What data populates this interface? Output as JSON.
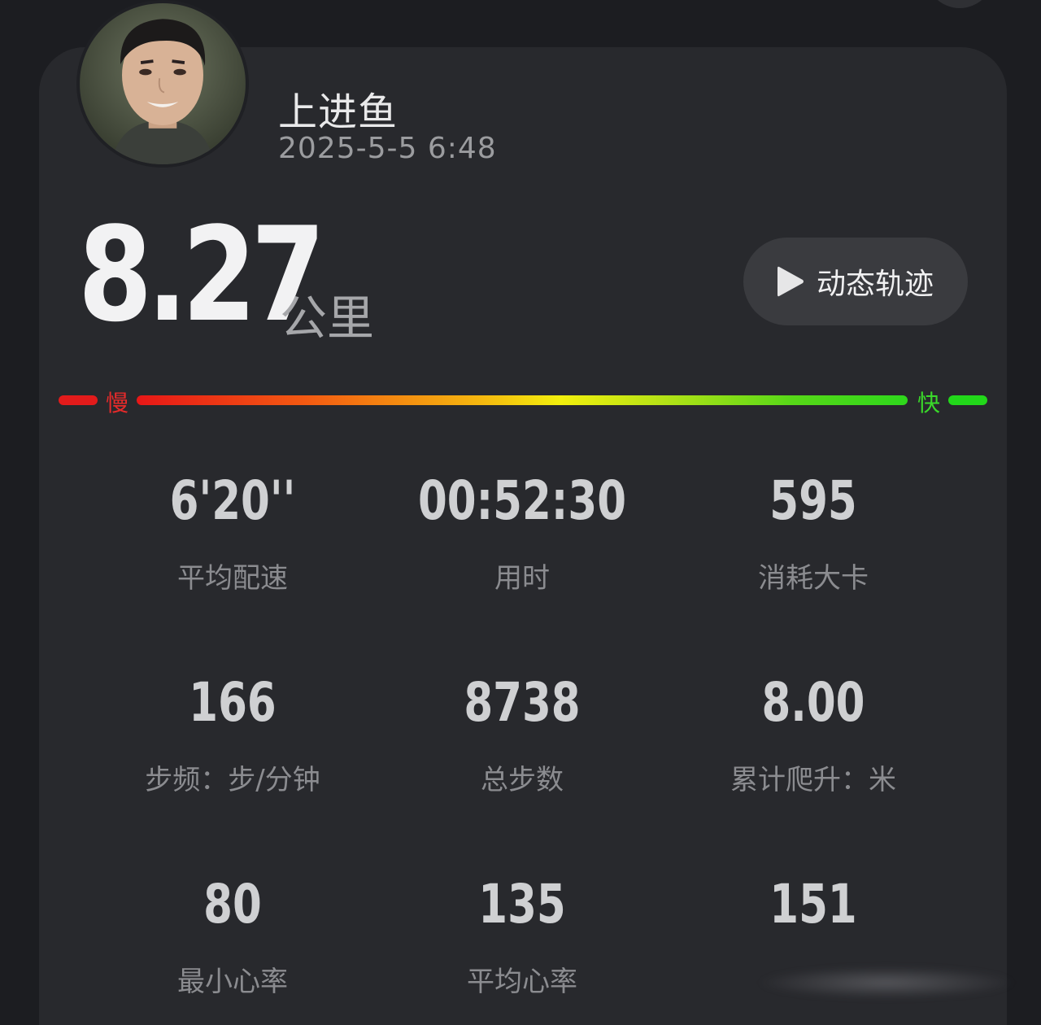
{
  "profile": {
    "name": "上进鱼",
    "timestamp": "2025-5-5 6:48"
  },
  "distance": {
    "value": "8.27",
    "unit": "公里"
  },
  "track_button": {
    "label": "动态轨迹",
    "icon": "play-icon"
  },
  "speed_legend": {
    "slow_label": "慢",
    "fast_label": "快",
    "slow_color": "#e71717",
    "fast_color": "#2ed81c"
  },
  "stats": [
    {
      "value": "6'20''",
      "label": "平均配速"
    },
    {
      "value": "00:52:30",
      "label": "用时"
    },
    {
      "value": "595",
      "label": "消耗大卡"
    },
    {
      "value": "166",
      "label": "步频：步/分钟"
    },
    {
      "value": "8738",
      "label": "总步数"
    },
    {
      "value": "8.00",
      "label": "累计爬升：米"
    },
    {
      "value": "80",
      "label": "最小心率"
    },
    {
      "value": "135",
      "label": "平均心率"
    },
    {
      "value": "151",
      "label": ""
    }
  ],
  "colors": {
    "background": "#1c1d21",
    "card": "#28292d",
    "button": "#3a3b3f"
  }
}
